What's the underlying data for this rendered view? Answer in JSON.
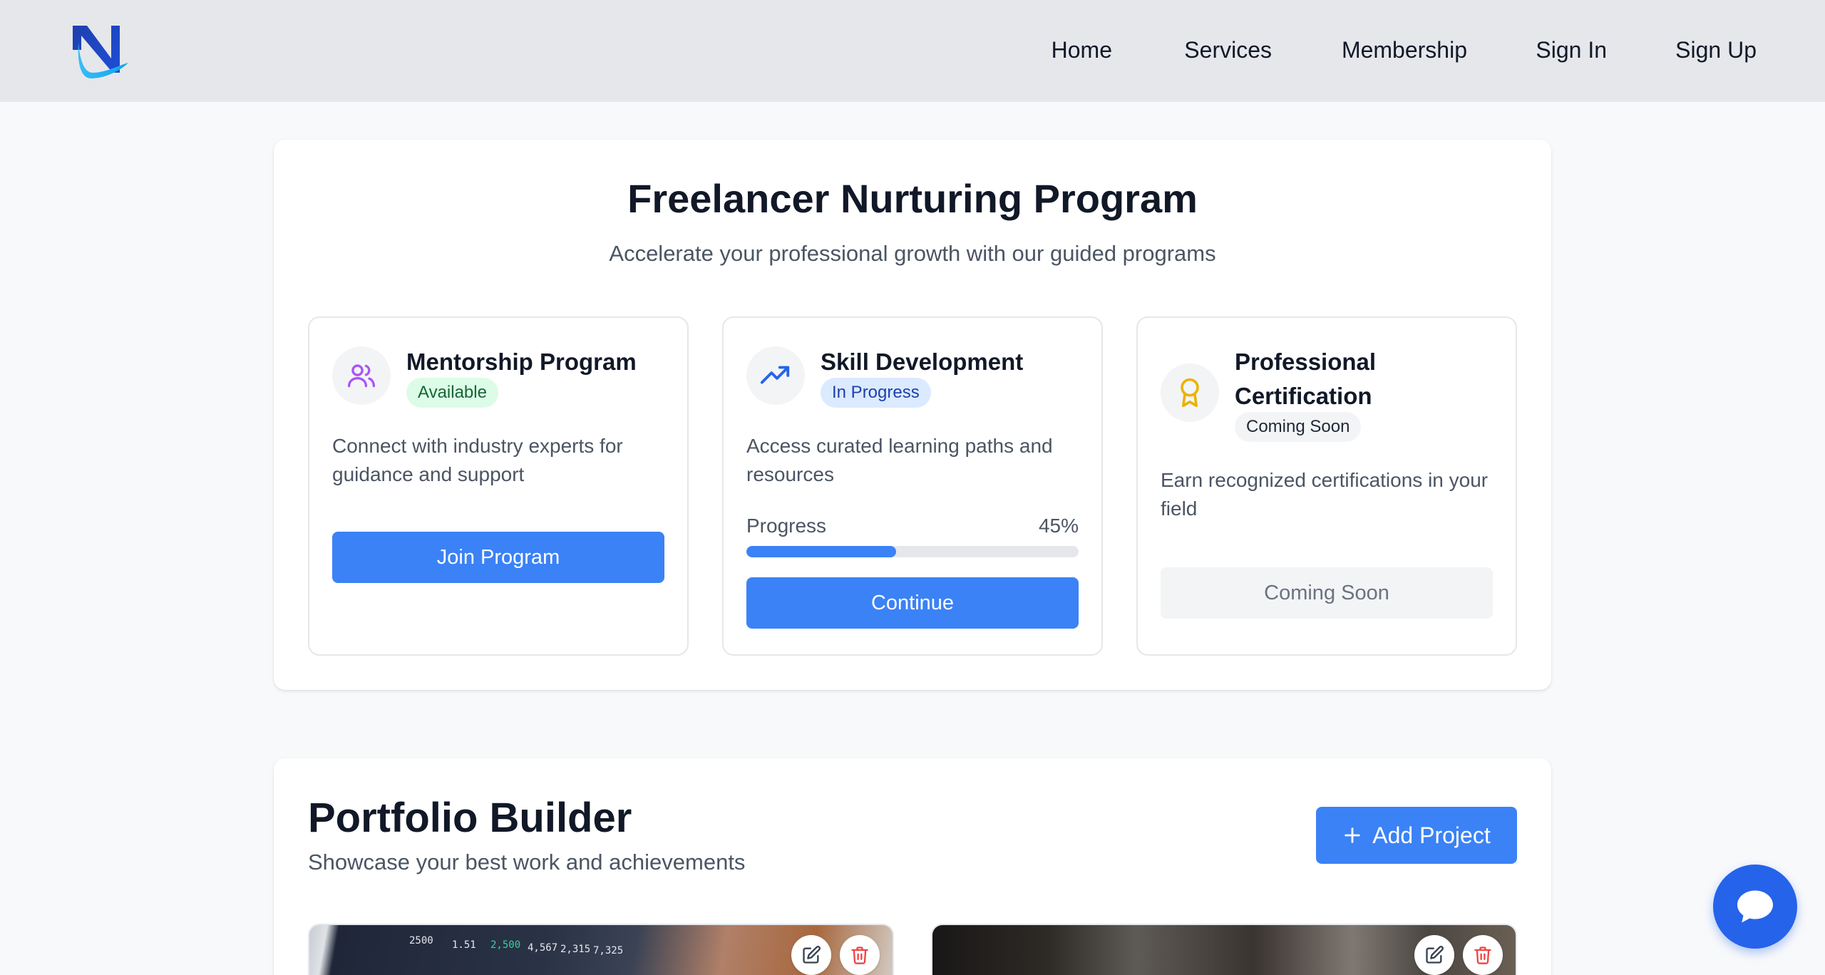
{
  "header": {
    "logo_letter": "N",
    "nav": [
      "Home",
      "Services",
      "Membership",
      "Sign In",
      "Sign Up"
    ]
  },
  "nurturing": {
    "title": "Freelancer Nurturing Program",
    "subtitle": "Accelerate your professional growth with our guided programs",
    "cards": [
      {
        "title": "Mentorship Program",
        "status": "Available",
        "icon": "users-icon",
        "description": "Connect with industry experts for guidance and support",
        "button": "Join Program"
      },
      {
        "title": "Skill Development",
        "status": "In Progress",
        "icon": "trending-up-icon",
        "description": "Access curated learning paths and resources",
        "progress_label": "Progress",
        "progress_value": "45%",
        "progress_fraction": 0.45,
        "button": "Continue"
      },
      {
        "title": "Professional Certification",
        "status": "Coming Soon",
        "icon": "award-icon",
        "description": "Earn recognized certifications in your field",
        "button": "Coming Soon"
      }
    ]
  },
  "portfolio": {
    "title": "Portfolio Builder",
    "subtitle": "Showcase your best work and achievements",
    "add_button": "Add Project",
    "projects": [
      {
        "image": "analytics-dashboard-photo",
        "dash_values": [
          "2500",
          "1.51",
          "2,500",
          "4,567",
          "2,315",
          "7,325"
        ]
      },
      {
        "image": "workspace-photo"
      }
    ]
  },
  "colors": {
    "accent": "#3b82f6",
    "accent_dark": "#2563eb",
    "header_bg": "#e5e7eb",
    "page_bg": "#f8f9fb",
    "available": "#dcfce7",
    "in_progress": "#dbeafe",
    "delete": "#ef4444"
  },
  "chat": {
    "icon": "chat-bubble-icon"
  }
}
